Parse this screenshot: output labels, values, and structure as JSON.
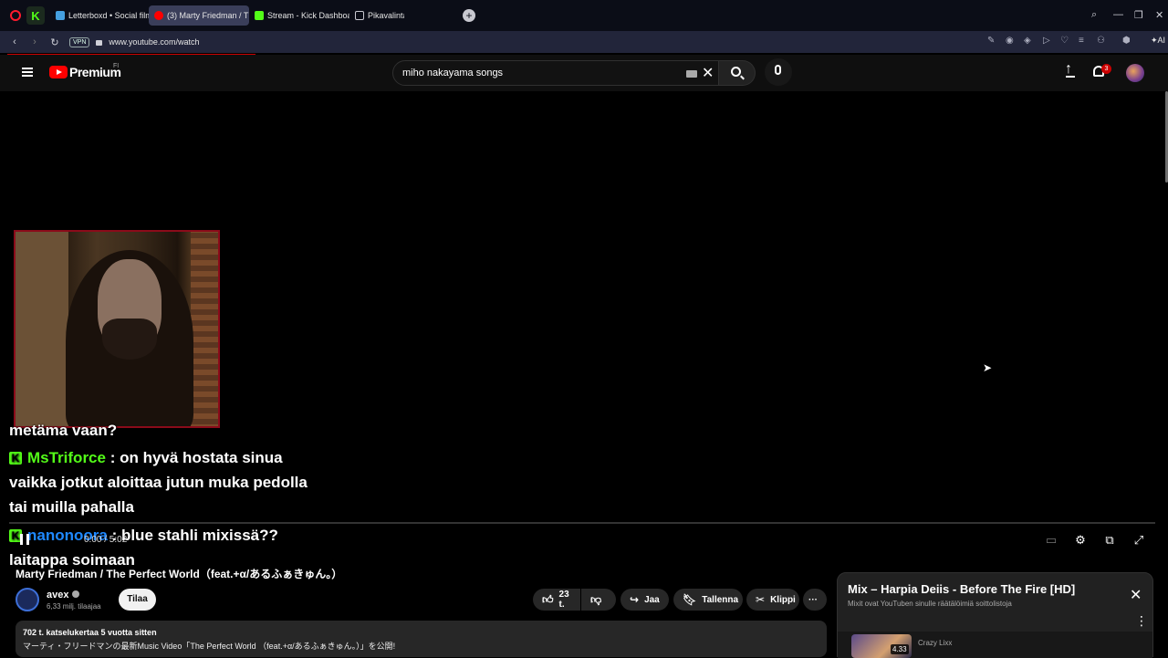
{
  "browser": {
    "tabs": [
      {
        "label": "Letterboxd • Social film di",
        "favicon_color": "#45a0e0"
      },
      {
        "label": "(3) Marty Friedman / The P",
        "favicon_color": "#ff0000",
        "active": true
      },
      {
        "label": "Stream - Kick Dashboard",
        "favicon_color": "#53fc18"
      },
      {
        "label": "Pikavalinta",
        "favicon_color": "#c8c8d0"
      }
    ],
    "new_tab": "+",
    "vpn": "VPN",
    "url": "www.youtube.com/watch",
    "ai_label": "AI"
  },
  "youtube": {
    "brand": "Premium",
    "country": "FI",
    "search_query": "miho nakayama songs",
    "notification_count": "3"
  },
  "player": {
    "chat": [
      {
        "user": "",
        "text": "metäma vaan?"
      },
      {
        "user": "MsTriforce",
        "text": " : on hyvä hostata sinua",
        "color": "#53fc18"
      },
      {
        "user": "",
        "text": "vaikka jotkut aloittaa jutun muka pedolla"
      },
      {
        "user": "",
        "text": "tai muilla pahalla"
      },
      {
        "user": "nanonoora",
        "text": " : blue stahli mixissä??",
        "color": "#1e88ff"
      },
      {
        "user": "",
        "text": "laitappa soimaan"
      }
    ],
    "time": "0:00 / 5:02"
  },
  "video": {
    "title": "Marty Friedman / The Perfect World（feat.+α/あるふぁきゅん。）",
    "channel": "avex",
    "subscribers": "6,33 milj. tilaajaa",
    "subscribe_label": "Tilaa",
    "likes": "23 t.",
    "share_label": "Jaa",
    "save_label": "Tallenna",
    "clip_label": "Klippi",
    "more_label": "···",
    "views_meta": "702 t. katselukertaa  5 vuotta sitten",
    "description": "マーティ・フリードマンの最新Music Video「The Perfect World （feat.+α/あるふぁきゅん。）」を公開!"
  },
  "mix": {
    "title": "Mix – Harpia Deiis - Before The Fire [HD]",
    "subtitle": "Mixit ovat YouTuben sinulle räätälöimiä soittolistoja",
    "item": {
      "duration": "4.33",
      "artist": "Crazy Lixx"
    }
  }
}
